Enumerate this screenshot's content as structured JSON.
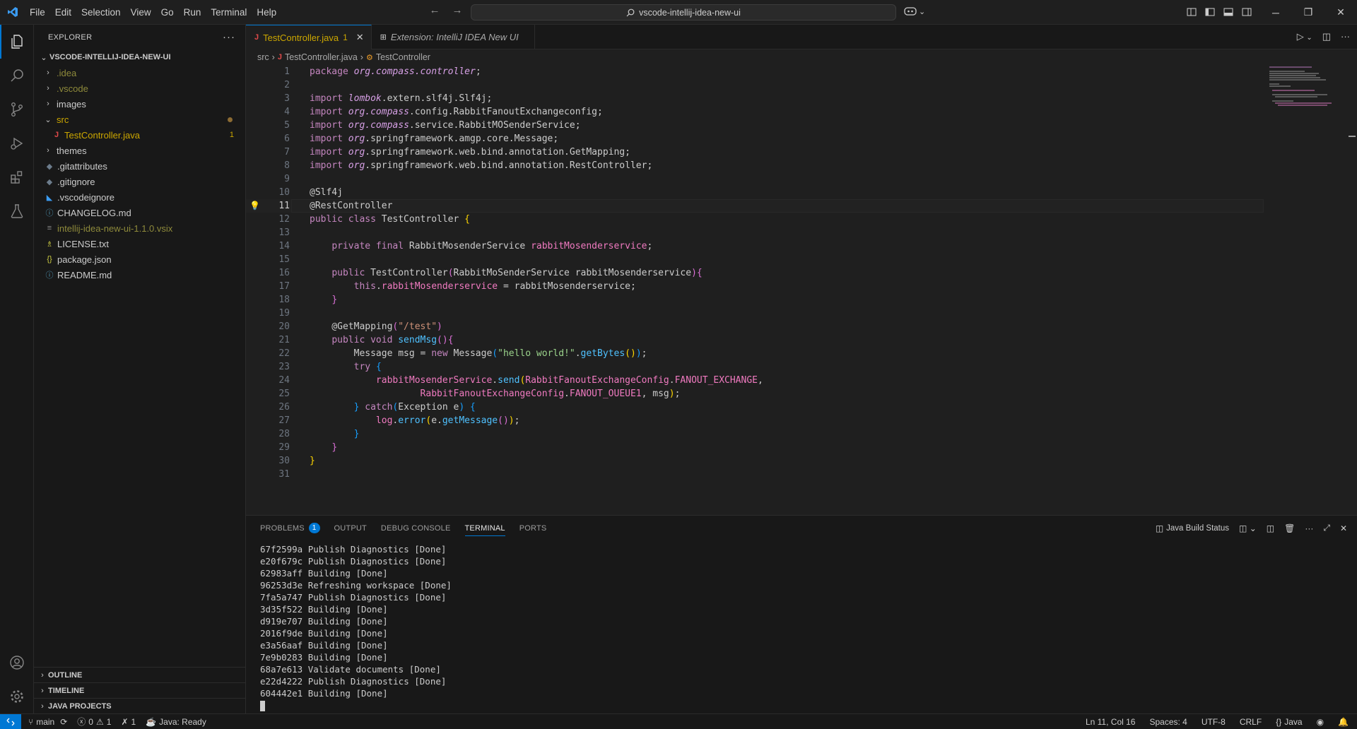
{
  "titlebar": {
    "menu": [
      "File",
      "Edit",
      "Selection",
      "View",
      "Go",
      "Run",
      "Terminal",
      "Help"
    ],
    "search_text": "vscode-intellij-idea-new-ui"
  },
  "explorer": {
    "header": "EXPLORER",
    "root": "VSCODE-INTELLIJ-IDEA-NEW-UI",
    "items": [
      {
        "label": ".idea",
        "color": "#8e8a3b",
        "icon": "chevron-right-icon"
      },
      {
        "label": ".vscode",
        "color": "#8e8a3b",
        "icon": "chevron-right-icon"
      },
      {
        "label": "images",
        "color": "#cccccc",
        "icon": "chevron-right-icon"
      },
      {
        "label": "src",
        "color": "#cca700",
        "icon": "chevron-down-icon"
      },
      {
        "label": "TestController.java",
        "color": "#cca700",
        "badge": "1",
        "icon": "java-file-icon"
      },
      {
        "label": "themes",
        "color": "#cccccc",
        "icon": "chevron-right-icon"
      },
      {
        "label": ".gitattributes",
        "color": "#cccccc",
        "icon": "git-file-icon"
      },
      {
        "label": ".gitignore",
        "color": "#cccccc",
        "icon": "git-file-icon"
      },
      {
        "label": ".vscodeignore",
        "color": "#cccccc",
        "icon": "vscode-file-icon"
      },
      {
        "label": "CHANGELOG.md",
        "color": "#cccccc",
        "icon": "info-file-icon"
      },
      {
        "label": "intellij-idea-new-ui-1.1.0.vsix",
        "color": "#8e8a3b",
        "icon": "lines-file-icon"
      },
      {
        "label": "LICENSE.txt",
        "color": "#cccccc",
        "icon": "license-file-icon"
      },
      {
        "label": "package.json",
        "color": "#cccccc",
        "icon": "json-file-icon"
      },
      {
        "label": "README.md",
        "color": "#cccccc",
        "icon": "info-file-icon"
      }
    ],
    "sections": [
      "OUTLINE",
      "TIMELINE",
      "JAVA PROJECTS"
    ]
  },
  "editor": {
    "tabs": [
      {
        "label": "TestController.java",
        "badge": "1"
      },
      {
        "label": "Extension: IntelliJ IDEA New UI"
      }
    ],
    "breadcrumb": [
      "src",
      "TestController.java",
      "TestController"
    ],
    "current_line": 11,
    "line_numbers": [
      "1",
      "2",
      "3",
      "4",
      "5",
      "6",
      "7",
      "8",
      "9",
      "10",
      "11",
      "12",
      "13",
      "14",
      "15",
      "16",
      "17",
      "18",
      "19",
      "20",
      "21",
      "22",
      "23",
      "24",
      "25",
      "26",
      "27",
      "28",
      "29",
      "30",
      "31"
    ]
  },
  "panel": {
    "tabs": [
      "PROBLEMS",
      "OUTPUT",
      "DEBUG CONSOLE",
      "TERMINAL",
      "PORTS"
    ],
    "problems_count": "1",
    "build_status": "Java Build Status",
    "terminal_lines": [
      "67f2599a Publish Diagnostics [Done]",
      "e20f679c Publish Diagnostics [Done]",
      "62983aff Building [Done]",
      "96253d3e Refreshing workspace [Done]",
      "7fa5a747 Publish Diagnostics [Done]",
      "3d35f522 Building [Done]",
      "d919e707 Building [Done]",
      "2016f9de Building [Done]",
      "e3a56aaf Building [Done]",
      "7e9b0283 Building [Done]",
      "68a7e613 Validate documents [Done]",
      "e22d4222 Publish Diagnostics [Done]",
      "604442e1 Building [Done]"
    ]
  },
  "statusbar": {
    "branch": "main",
    "errors": "0",
    "warnings": "1",
    "ports": "1",
    "java": "Java: Ready",
    "position": "Ln 11, Col 16",
    "spaces": "Spaces: 4",
    "encoding": "UTF-8",
    "eol": "CRLF",
    "language": "Java"
  },
  "colors": {
    "accent": "#0078d4",
    "modified": "#cca700"
  }
}
